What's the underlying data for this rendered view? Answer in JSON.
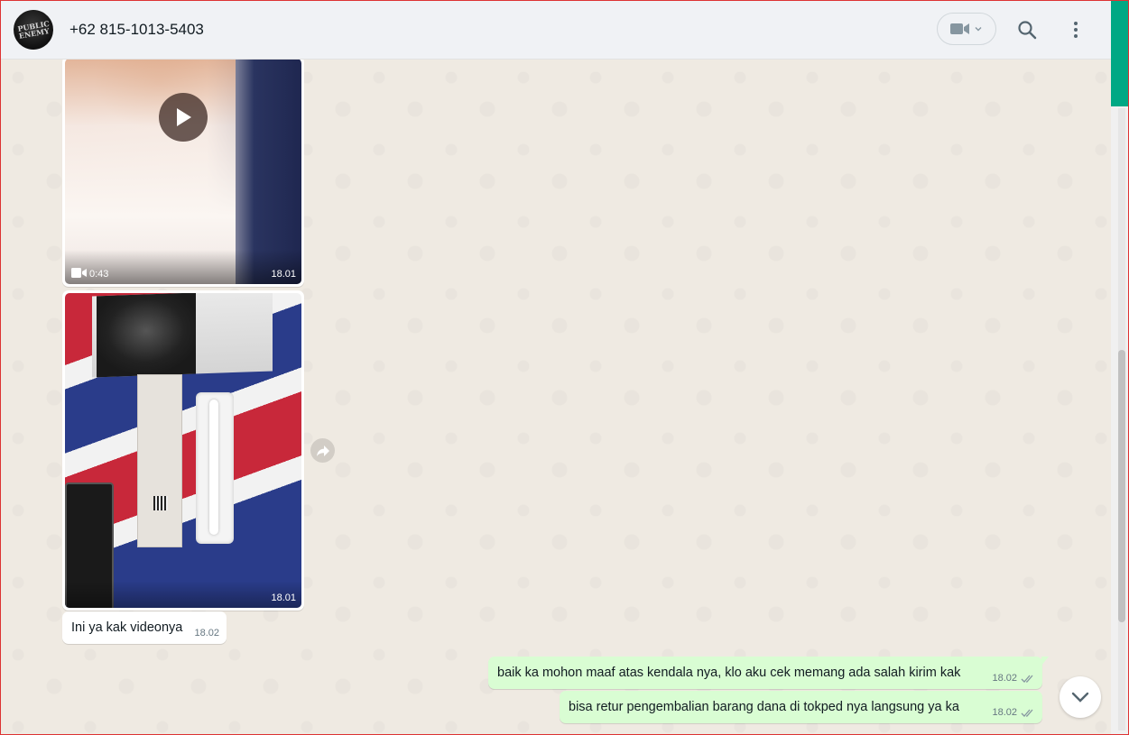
{
  "header": {
    "avatar_text": "PUBLIC ENEMY",
    "contact_name": "+62 815-1013-5403",
    "icons": [
      "video-call-icon",
      "chevron-down-icon",
      "search-icon",
      "menu-icon"
    ]
  },
  "messages": {
    "video": {
      "duration": "0:43",
      "time": "18.01"
    },
    "photo": {
      "time": "18.01"
    },
    "incoming_text": {
      "text": "Ini ya kak videonya",
      "time": "18.02"
    },
    "outgoing": [
      {
        "text": "baik ka mohon maaf atas kendala nya, klo aku cek memang ada salah kirim kak",
        "time": "18.02",
        "status": "read-ticks"
      },
      {
        "text": "bisa retur pengembalian barang dana di tokped nya langsung ya ka",
        "time": "18.02",
        "status": "read-ticks"
      }
    ]
  },
  "colors": {
    "header_bg": "#f0f2f5",
    "chat_bg": "#efeae2",
    "outgoing_bubble": "#d9fdd3",
    "incoming_bubble": "#ffffff",
    "accent": "#00a884"
  }
}
